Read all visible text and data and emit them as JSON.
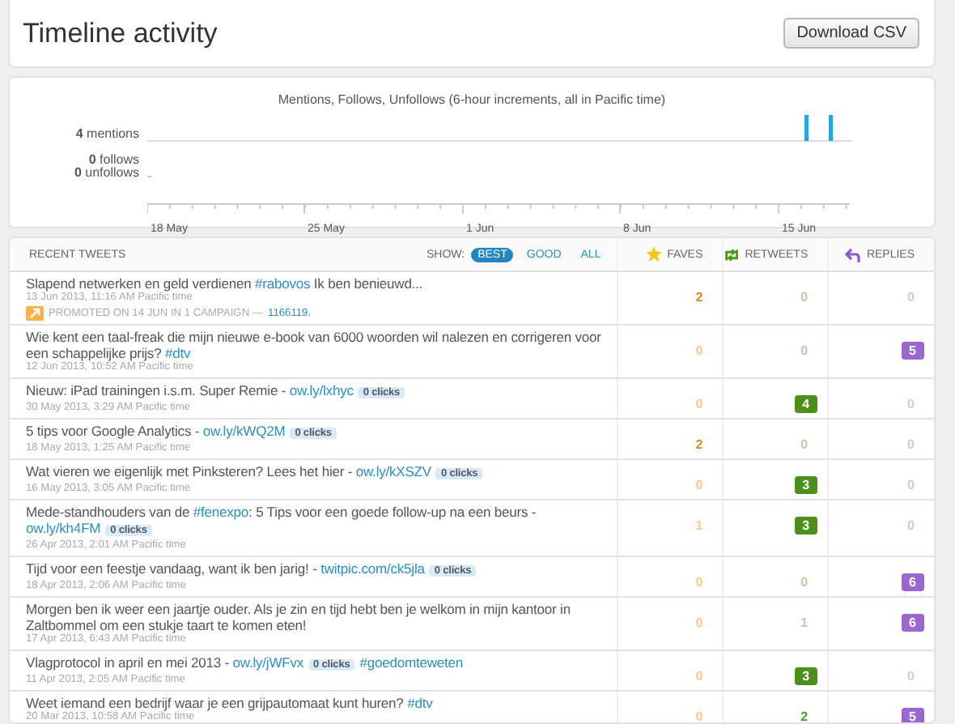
{
  "header": {
    "title": "Timeline activity",
    "button": "Download CSV"
  },
  "chart": {
    "title": "Mentions, Follows, Unfollows (6-hour increments, all in Pacific time)",
    "labels": [
      "**4** mentions",
      "**0** follows",
      "**0** unfollows"
    ],
    "axis_labels": [
      "18 May",
      "25 May",
      "1 Jun",
      "8 Jun",
      "15 Jun"
    ]
  },
  "table": {
    "columns": {
      "tweets": "RECENT TWEETS",
      "show": "SHOW:",
      "faves": "FAVES",
      "retweets": "RETWEETS",
      "replies": "REPLIES"
    },
    "filters": [
      {
        "label": "BEST",
        "selected": true
      },
      {
        "label": "GOOD",
        "selected": false
      },
      {
        "label": "ALL",
        "selected": false
      }
    ],
    "rows": [
      {
        "parts": [
          {
            "kind": "text",
            "text": "Slapend netwerken en geld verdienen "
          },
          {
            "kind": "link",
            "text": "#rabovos"
          },
          {
            "kind": "text",
            "text": " Ik ben benieuwd..."
          }
        ],
        "date": "13 Jun 2013, 11:16 AM Pacific time",
        "promo": {
          "text": "PROMOTED ON 14 JUN IN 1 CAMPAIGN —",
          "link": "1166119."
        },
        "faves": {
          "value": "2",
          "kind": "bold"
        },
        "retweets": {
          "value": "0",
          "kind": "faint"
        },
        "replies": {
          "value": "0",
          "kind": "faint"
        }
      },
      {
        "parts": [
          {
            "kind": "text",
            "text": "Wie kent een taal-freak die mijn nieuwe e-book van 6000 woorden wil nalezen en corrigeren voor een schappelijke prijs? "
          },
          {
            "kind": "link",
            "text": "#dtv"
          }
        ],
        "date": "12 Jun 2013, 10:52 AM Pacific time",
        "faves": {
          "value": "0",
          "kind": "faint"
        },
        "retweets": {
          "value": "0",
          "kind": "faint"
        },
        "replies": {
          "value": "5",
          "kind": "badge"
        }
      },
      {
        "parts": [
          {
            "kind": "text",
            "text": "Nieuw: iPad trainingen i.s.m. Super Remie - "
          },
          {
            "kind": "link",
            "text": "ow.ly/lxhyc"
          },
          {
            "kind": "clicks",
            "text": "0 clicks"
          }
        ],
        "date": "30 May 2013, 3:29 AM Pacific time",
        "faves": {
          "value": "0",
          "kind": "faint"
        },
        "retweets": {
          "value": "4",
          "kind": "badge"
        },
        "replies": {
          "value": "0",
          "kind": "faint"
        }
      },
      {
        "parts": [
          {
            "kind": "text",
            "text": "5 tips voor Google Analytics - "
          },
          {
            "kind": "link",
            "text": "ow.ly/kWQ2M"
          },
          {
            "kind": "clicks",
            "text": "0 clicks"
          }
        ],
        "date": "18 May 2013, 1:25 AM Pacific time",
        "faves": {
          "value": "2",
          "kind": "bold"
        },
        "retweets": {
          "value": "0",
          "kind": "faint"
        },
        "replies": {
          "value": "0",
          "kind": "faint"
        }
      },
      {
        "parts": [
          {
            "kind": "text",
            "text": "Wat vieren we eigenlijk met Pinksteren? Lees het hier - "
          },
          {
            "kind": "link",
            "text": "ow.ly/kXSZV"
          },
          {
            "kind": "clicks",
            "text": "0 clicks"
          }
        ],
        "date": "16 May 2013, 3:05 AM Pacific time",
        "faves": {
          "value": "0",
          "kind": "faint"
        },
        "retweets": {
          "value": "3",
          "kind": "badge"
        },
        "replies": {
          "value": "0",
          "kind": "faint"
        }
      },
      {
        "parts": [
          {
            "kind": "text",
            "text": "Mede-standhouders van de "
          },
          {
            "kind": "link",
            "text": "#fenexpo"
          },
          {
            "kind": "text",
            "text": ": 5 Tips voor een goede follow-up na een beurs - "
          },
          {
            "kind": "link",
            "text": "ow.ly/kh4FM"
          },
          {
            "kind": "clicks",
            "text": "0 clicks"
          }
        ],
        "date": "26 Apr 2013, 2:01 AM Pacific time",
        "faves": {
          "value": "1",
          "kind": "faint"
        },
        "retweets": {
          "value": "3",
          "kind": "badge"
        },
        "replies": {
          "value": "0",
          "kind": "faint"
        }
      },
      {
        "parts": [
          {
            "kind": "text",
            "text": "Tijd voor een feestje vandaag, want ik ben jarig! - "
          },
          {
            "kind": "link",
            "text": "twitpic.com/ck5jla"
          },
          {
            "kind": "clicks",
            "text": "0 clicks"
          }
        ],
        "date": "18 Apr 2013, 2:06 AM Pacific time",
        "faves": {
          "value": "0",
          "kind": "faint"
        },
        "retweets": {
          "value": "0",
          "kind": "faint"
        },
        "replies": {
          "value": "6",
          "kind": "badge"
        }
      },
      {
        "parts": [
          {
            "kind": "text",
            "text": "Morgen ben ik weer een jaartje ouder. Als je zin en tijd hebt ben je welkom in mijn kantoor in Zaltbommel om een stukje taart te komen eten!"
          }
        ],
        "date": "17 Apr 2013, 6:43 AM Pacific time",
        "faves": {
          "value": "0",
          "kind": "faint"
        },
        "retweets": {
          "value": "1",
          "kind": "faint"
        },
        "replies": {
          "value": "6",
          "kind": "badge"
        }
      },
      {
        "parts": [
          {
            "kind": "text",
            "text": "Vlagprotocol in april en mei 2013 - "
          },
          {
            "kind": "link",
            "text": "ow.ly/jWFvx"
          },
          {
            "kind": "clicks",
            "text": "0 clicks"
          },
          {
            "kind": "link",
            "text": "#goedomteweten"
          }
        ],
        "date": "11 Apr 2013, 2:05 AM Pacific time",
        "faves": {
          "value": "0",
          "kind": "faint"
        },
        "retweets": {
          "value": "3",
          "kind": "badge"
        },
        "replies": {
          "value": "0",
          "kind": "faint"
        }
      },
      {
        "parts": [
          {
            "kind": "text",
            "text": "Weet iemand een bedrijf waar je een grijpautomaat kunt huren? "
          },
          {
            "kind": "link",
            "text": "#dtv"
          }
        ],
        "date": "20 Mar 2013, 10:58 AM Pacific time",
        "faves": {
          "value": "0",
          "kind": "faint"
        },
        "retweets": {
          "value": "2",
          "kind": "bold"
        },
        "replies": {
          "value": "5",
          "kind": "badge"
        }
      }
    ]
  }
}
